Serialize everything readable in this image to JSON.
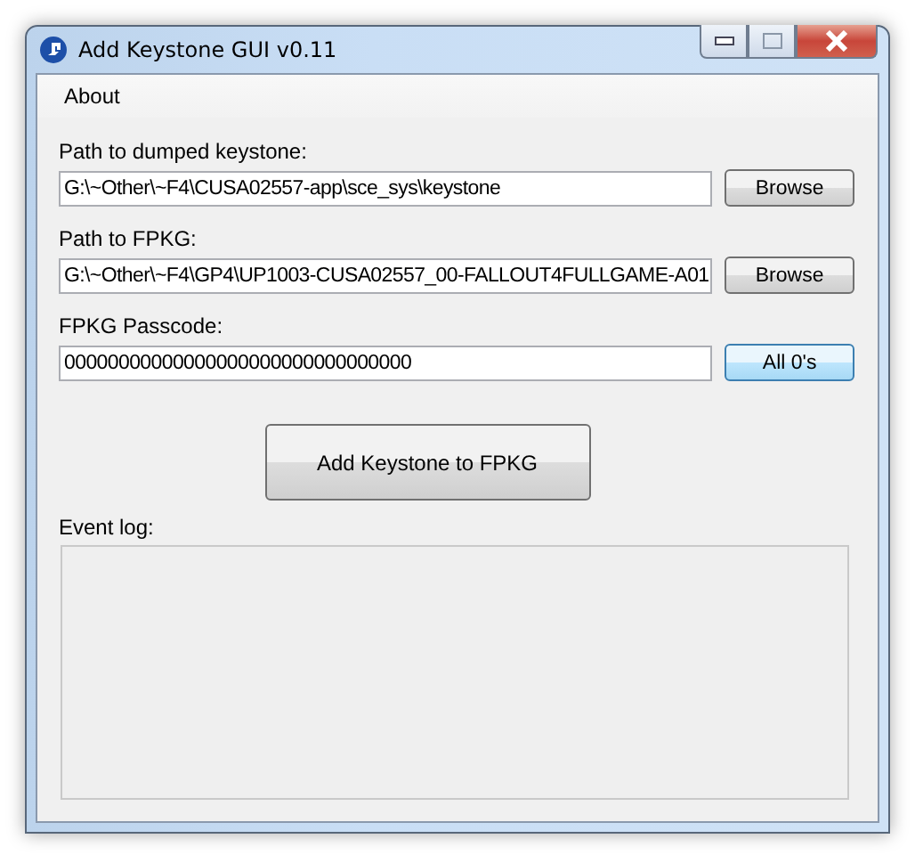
{
  "window": {
    "title": "Add Keystone GUI v0.11"
  },
  "menu": [
    {
      "label": "About"
    }
  ],
  "fields": [
    {
      "label": "Path to dumped keystone:",
      "value": "G:\\~Other\\~F4\\CUSA02557-app\\sce_sys\\keystone",
      "button": "Browse",
      "focused": false
    },
    {
      "label": "Path to FPKG:",
      "value": "G:\\~Other\\~F4\\GP4\\UP1003-CUSA02557_00-FALLOUT4FULLGAME-A01",
      "button": "Browse",
      "focused": false
    },
    {
      "label": "FPKG Passcode:",
      "value": "00000000000000000000000000000000",
      "button": "All 0's",
      "focused": true
    }
  ],
  "action_button": "Add Keystone to FPKG",
  "event_log": {
    "label": "Event log:"
  }
}
